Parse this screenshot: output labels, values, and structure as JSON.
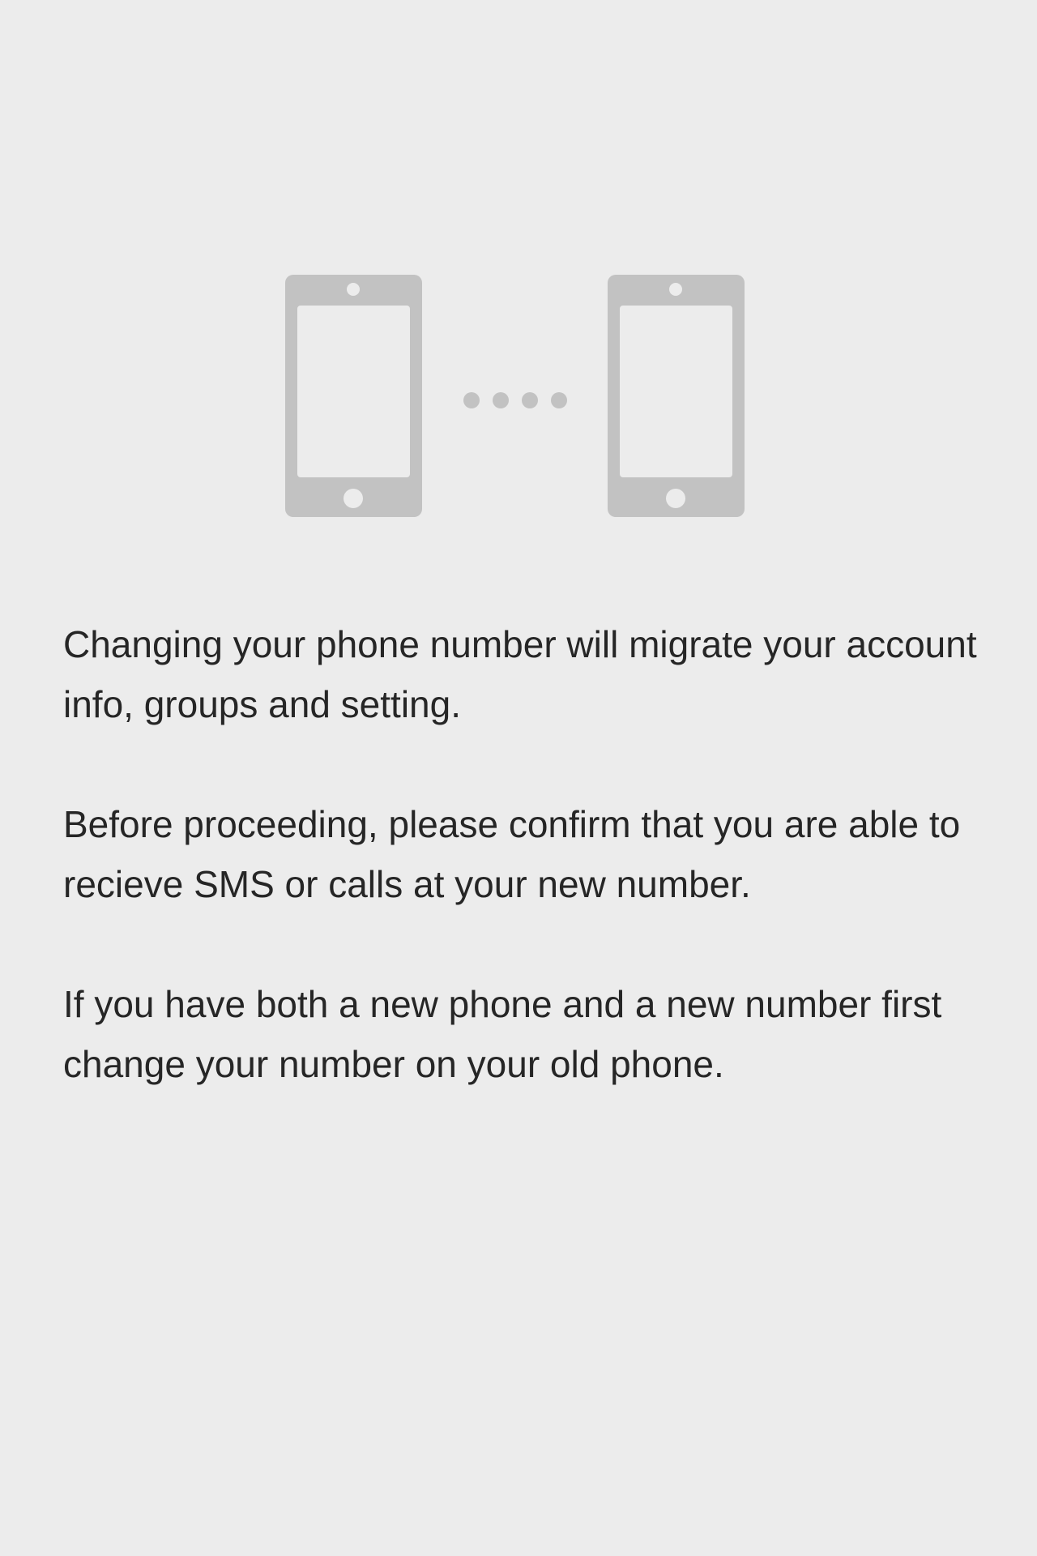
{
  "screen": {
    "paragraphs": [
      "Changing your phone number will migrate your account info, groups and setting.",
      "Before proceeding, please confirm that you are able to recieve SMS or calls at your new number.",
      "If you have both a new phone and a new number first change your number on your old phone."
    ]
  },
  "illustration": {
    "icons": [
      "old-phone-icon",
      "transfer-dots-icon",
      "new-phone-icon"
    ]
  },
  "colors": {
    "background": "#ececec",
    "illustration": "#c2c2c2",
    "text": "#262626"
  }
}
